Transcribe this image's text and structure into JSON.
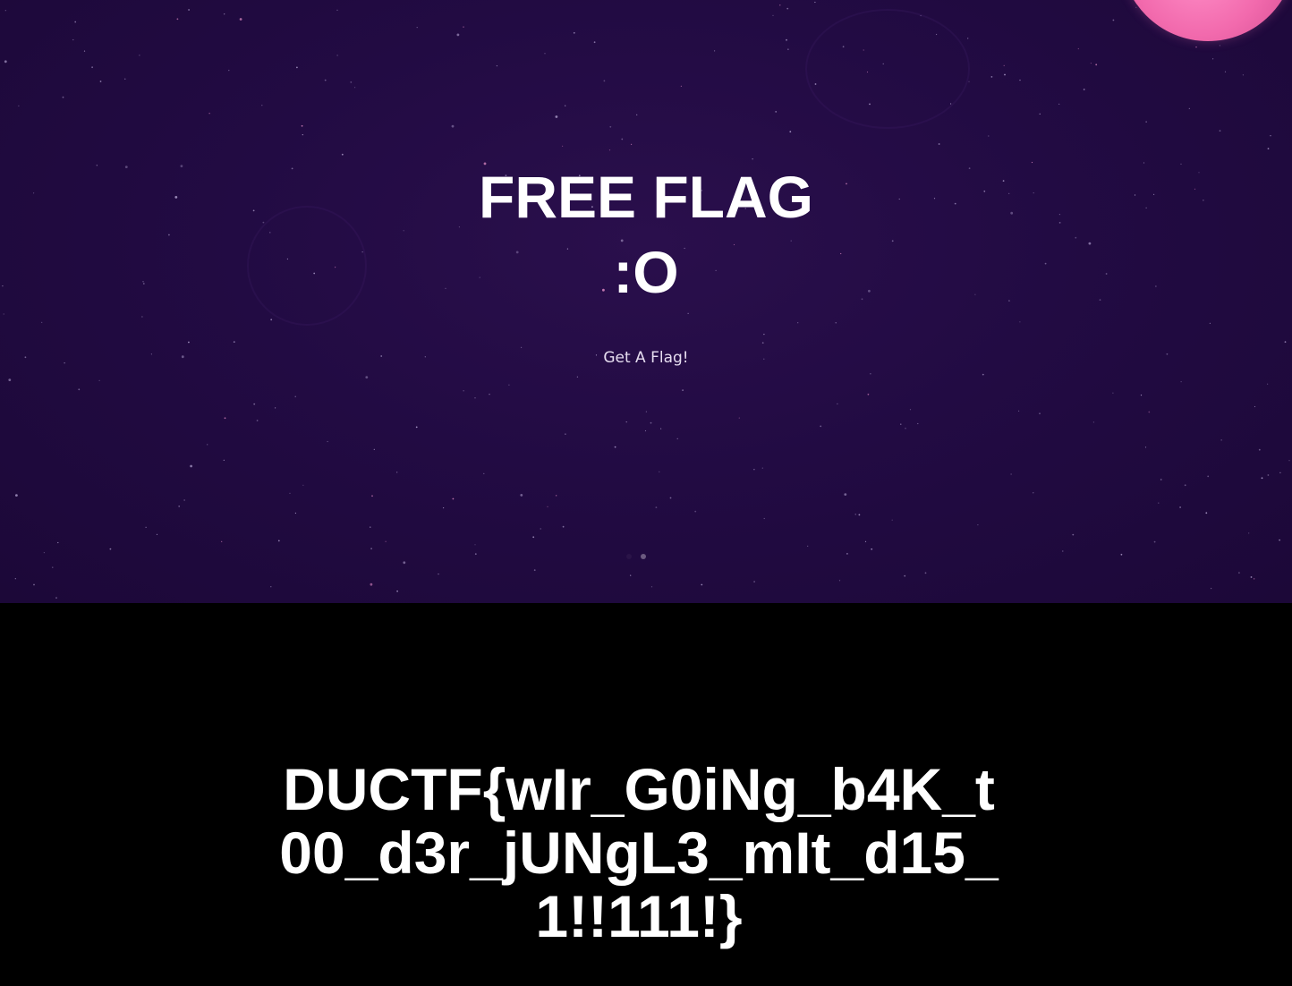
{
  "hero": {
    "title_line1": "FREE FLAG",
    "title_line2": ":O",
    "cta_label": "Get A Flag!",
    "background_color": "#220b43",
    "planet_color": "#f26aad",
    "slide_count": 2,
    "active_slide": 2
  },
  "flag_section": {
    "flag_text": "DUCTF{wIr_G0iNg_b4K_t00_d3r_jUNgL3_mIt_d15_1!!111!}",
    "background_color": "#000000"
  }
}
